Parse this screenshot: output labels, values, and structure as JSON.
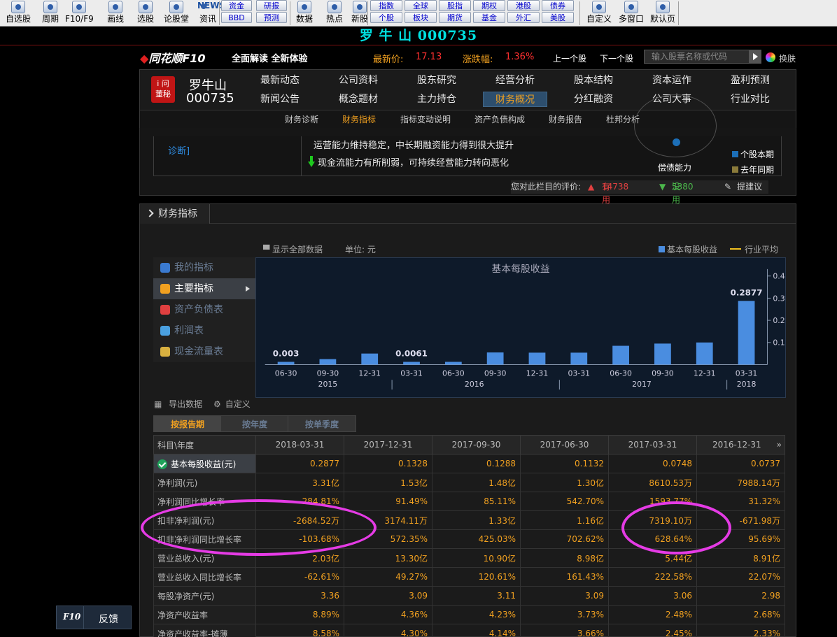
{
  "toolbar": {
    "items": [
      {
        "label": "自选股",
        "icon": "star-icon"
      },
      {
        "label": "周期",
        "icon": "clock-icon"
      },
      {
        "label": "F10/F9",
        "icon": "f10-icon"
      },
      {
        "label": "画线",
        "icon": "pen-icon"
      },
      {
        "label": "选股",
        "icon": "screen-icon"
      },
      {
        "label": "论股堂",
        "icon": "lun-icon"
      },
      {
        "label": "资讯",
        "icon": "news-icon"
      }
    ],
    "news_text": "NEWS",
    "small_buttons": [
      "资金",
      "研报",
      "BBD",
      "预测"
    ],
    "items2": [
      {
        "label": "数据",
        "icon": "pe-icon"
      },
      {
        "label": "热点",
        "icon": "hot-icon"
      },
      {
        "label": "新股",
        "icon": "new-stock-icon"
      }
    ],
    "market_buttons": [
      "指数",
      "全球",
      "股指",
      "期权",
      "港股",
      "债券",
      "个股",
      "板块",
      "期货",
      "基金",
      "外汇",
      "美股"
    ],
    "items3": [
      {
        "label": "自定义",
        "icon": "custom-icon"
      },
      {
        "label": "多窗口",
        "icon": "multi-window-icon"
      },
      {
        "label": "默认页",
        "icon": "home-icon"
      }
    ]
  },
  "title": "罗 牛 山 000735",
  "header": {
    "logo": "同花顺F10",
    "slogan": "全面解读 全新体验",
    "latest_price_label": "最新价:",
    "latest_price": "17.13",
    "change_label": "涨跌幅:",
    "change": "1.36%",
    "prev_stock": "上一个股",
    "next_stock": "下一个股",
    "search_placeholder": "输入股票名称或代码",
    "skin_label": "换肤"
  },
  "stock": {
    "icon_text_1": "i 问",
    "icon_text_2": "董秘",
    "name": "罗牛山",
    "code": "000735"
  },
  "main_tabs": [
    [
      "最新动态",
      "公司资料",
      "股东研究",
      "经营分析",
      "股本结构",
      "资本运作",
      "盈利预测"
    ],
    [
      "新闻公告",
      "概念题材",
      "主力持仓",
      "财务概况",
      "分红融资",
      "公司大事",
      "行业对比"
    ]
  ],
  "active_main_tab": "财务概况",
  "sub_tabs": [
    "财务诊断",
    "财务指标",
    "指标变动说明",
    "资产负债构成",
    "财务报告",
    "杜邦分析"
  ],
  "active_sub_tab": "财务指标",
  "diagnosis": {
    "link": "诊断]",
    "line1": "运营能力维持稳定，中长期融资能力得到很大提升",
    "line2": "现金流能力有所削弱，可持续经营能力转向恶化",
    "radar_label": "偿债能力",
    "legend_current": "个股本期",
    "legend_last": "去年同期",
    "legend_current_color": "#1c6fb8",
    "legend_last_color": "#8a7a3a",
    "rating_prompt": "您对此栏目的评价:",
    "useful_label": "有用",
    "useful_count": "14738",
    "useless_label": "没用",
    "useless_count": "5380",
    "suggest_label": "提建议"
  },
  "fin": {
    "title": "财务指标",
    "show_all": "显示全部数据",
    "unit": "单位: 元",
    "legend_series": "基本每股收益",
    "legend_avg": "行业平均",
    "left_menu": [
      "我的指标",
      "主要指标",
      "资产负债表",
      "利润表",
      "现金流量表"
    ],
    "active_menu": "主要指标",
    "export_label": "导出数据",
    "custom_label": "自定义",
    "report_tabs": [
      "按报告期",
      "按年度",
      "按单季度"
    ],
    "active_report_tab": "按报告期"
  },
  "chart_data": {
    "type": "bar",
    "title": "基本每股收益",
    "categories": [
      "06-30",
      "09-30",
      "12-31",
      "03-31",
      "06-30",
      "09-30",
      "12-31",
      "03-31",
      "06-30",
      "09-30",
      "12-31",
      "03-31"
    ],
    "values": [
      0.003,
      0.025,
      0.05,
      0.0061,
      0.012,
      0.055,
      0.054,
      0.054,
      0.085,
      0.095,
      0.1,
      0.2877
    ],
    "value_labels": [
      "0.003",
      "",
      "",
      "0.0061",
      "",
      "",
      "",
      "",
      "",
      "",
      "",
      "0.2877"
    ],
    "year_groups": [
      {
        "label": "2015",
        "span": 3
      },
      {
        "label": "2016",
        "span": 4
      },
      {
        "label": "2017",
        "span": 4
      },
      {
        "label": "2018",
        "span": 1
      }
    ],
    "y_ticks": [
      "0.1",
      "0.2",
      "0.3",
      "0.4"
    ],
    "ylim": [
      0,
      0.4
    ],
    "bar_color": "#4a8de0",
    "grid": false
  },
  "table": {
    "corner": "科目\\年度",
    "columns": [
      "2018-03-31",
      "2017-12-31",
      "2017-09-30",
      "2017-06-30",
      "2017-03-31",
      "2016-12-31"
    ],
    "rows": [
      {
        "label": "基本每股收益(元)",
        "values": [
          "0.2877",
          "0.1328",
          "0.1288",
          "0.1132",
          "0.0748",
          "0.0737"
        ]
      },
      {
        "label": "净利润(元)",
        "values": [
          "3.31亿",
          "1.53亿",
          "1.48亿",
          "1.30亿",
          "8610.53万",
          "7988.14万"
        ]
      },
      {
        "label": "净利润同比增长率",
        "values": [
          "284.81%",
          "91.49%",
          "85.11%",
          "542.70%",
          "1593.77%",
          "31.32%"
        ]
      },
      {
        "label": "扣非净利润(元)",
        "values": [
          "-2684.52万",
          "3174.11万",
          "1.33亿",
          "1.16亿",
          "7319.10万",
          "-671.98万"
        ]
      },
      {
        "label": "扣非净利润同比增长率",
        "values": [
          "-103.68%",
          "572.35%",
          "425.03%",
          "702.62%",
          "628.64%",
          "95.69%"
        ]
      },
      {
        "label": "营业总收入(元)",
        "values": [
          "2.03亿",
          "13.30亿",
          "10.90亿",
          "8.98亿",
          "5.44亿",
          "8.91亿"
        ]
      },
      {
        "label": "营业总收入同比增长率",
        "values": [
          "-62.61%",
          "49.27%",
          "120.61%",
          "161.43%",
          "222.58%",
          "22.07%"
        ]
      },
      {
        "label": "每股净资产(元)",
        "values": [
          "3.36",
          "3.09",
          "3.11",
          "3.09",
          "3.06",
          "2.98"
        ]
      },
      {
        "label": "净资产收益率",
        "values": [
          "8.89%",
          "4.36%",
          "4.23%",
          "3.73%",
          "2.48%",
          "2.68%"
        ]
      },
      {
        "label": "净资产收益率-摊薄",
        "values": [
          "8.58%",
          "4.30%",
          "4.14%",
          "3.66%",
          "2.45%",
          "2.33%"
        ]
      }
    ]
  },
  "feedback": {
    "f10": "F10",
    "label": "反馈"
  },
  "annotation_color": "#e53be5"
}
